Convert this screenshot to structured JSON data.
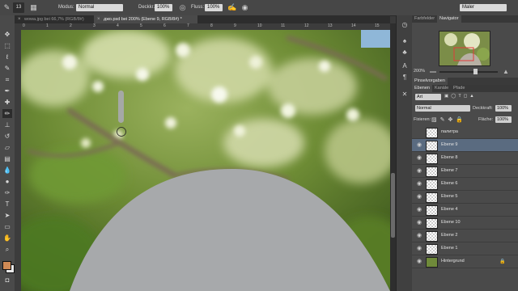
{
  "options_bar": {
    "brush_size": "13",
    "mode_label": "Modus:",
    "mode_value": "Normal",
    "opacity_label": "Deckkr.:",
    "opacity_value": "100%",
    "flow_label": "Fluss:",
    "flow_value": "100%",
    "workspace_value": "Maler"
  },
  "tabs": [
    {
      "label": "wowa.jpg bei 66,7% (RGB/8#)",
      "active": false
    },
    {
      "label": "джо.psd bei 200% (Ebene 9, RGB/8#) *",
      "active": true
    }
  ],
  "ruler_ticks": [
    "0",
    "1",
    "2",
    "3",
    "4",
    "5",
    "6",
    "7",
    "8",
    "9",
    "10",
    "11",
    "12",
    "13",
    "14",
    "15"
  ],
  "toolbox_icons": [
    "move-icon",
    "marquee-icon",
    "lasso-icon",
    "quick-select-icon",
    "crop-icon",
    "eyedropper-icon",
    "healing-icon",
    "brush-icon",
    "stamp-icon",
    "history-brush-icon",
    "eraser-icon",
    "gradient-icon",
    "blur-icon",
    "dodge-icon",
    "pen-icon",
    "type-icon",
    "path-select-icon",
    "shape-icon",
    "hand-icon",
    "zoom-icon"
  ],
  "navigator": {
    "tabs": [
      "Farbfelder",
      "Navigator"
    ],
    "zoom": "200%"
  },
  "layers_panel": {
    "group_title": "Pinselvorgaben",
    "tabs": [
      "Ebenen",
      "Kanäle",
      "Pfade"
    ],
    "kind_filter": "Art",
    "blend_mode": "Normal",
    "opacity_label": "Deckkraft:",
    "opacity_value": "100%",
    "lock_label": "Fixieren:",
    "fill_label": "Fläche:",
    "fill_value": "100%",
    "layers": [
      {
        "name": "палитра",
        "selected": false,
        "visible": false
      },
      {
        "name": "Ebene 9",
        "selected": true,
        "visible": true
      },
      {
        "name": "Ebene 8",
        "selected": false,
        "visible": true
      },
      {
        "name": "Ebene 7",
        "selected": false,
        "visible": true
      },
      {
        "name": "Ebene 6",
        "selected": false,
        "visible": true
      },
      {
        "name": "Ebene 5",
        "selected": false,
        "visible": true
      },
      {
        "name": "Ebene 4",
        "selected": false,
        "visible": true
      },
      {
        "name": "Ebene 10",
        "selected": false,
        "visible": true
      },
      {
        "name": "Ebene 2",
        "selected": false,
        "visible": true
      },
      {
        "name": "Ebene 1",
        "selected": false,
        "visible": true
      },
      {
        "name": "Hintergrund",
        "selected": false,
        "visible": true,
        "locked": true
      }
    ]
  },
  "colors": {
    "foreground": "#d08a55",
    "background": "#e8e8e8",
    "selected_layer": "#5a6b80",
    "shape_gray": "#a7a9ab"
  }
}
